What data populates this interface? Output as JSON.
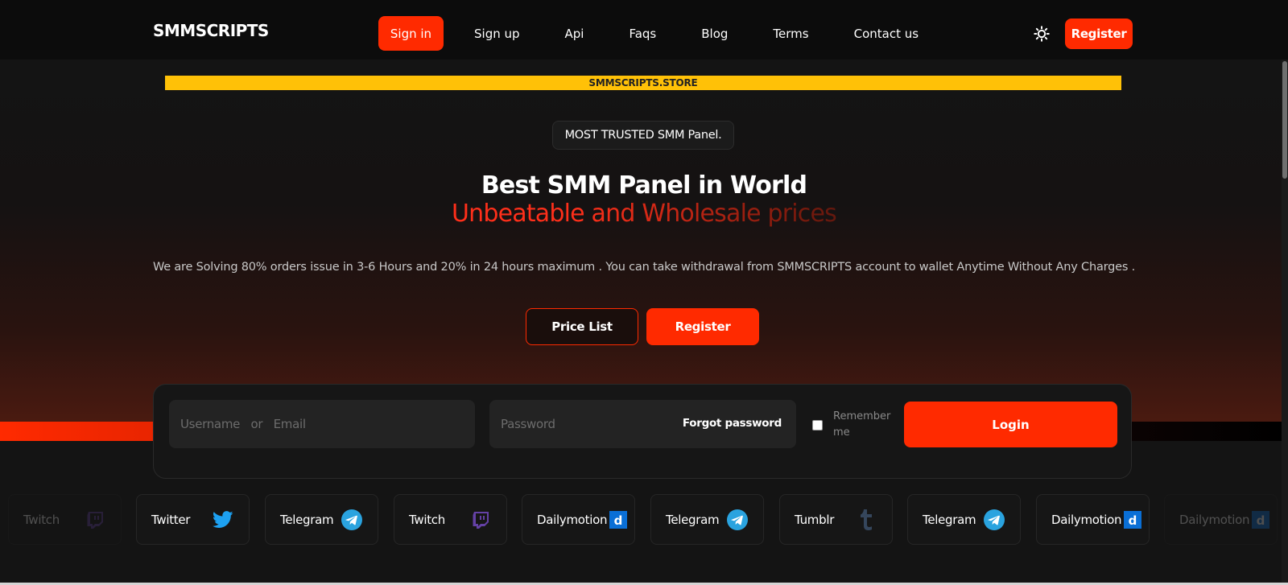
{
  "brand": "SMMSCRIPTS",
  "nav": {
    "items": [
      "Sign in",
      "Sign up",
      "Api",
      "Faqs",
      "Blog",
      "Terms",
      "Contact us"
    ],
    "active_index": 0,
    "register_label": "Register"
  },
  "banner": "SMMSCRIPTS.STORE",
  "hero": {
    "pill": "MOST TRUSTED SMM Panel.",
    "title": "Best SMM Panel in World",
    "subtitle": "Unbeatable and Wholesale prices",
    "description": "We are Solving 80% orders issue in 3-6 Hours and 20% in 24 hours maximum . You can take withdrawal from SMMSCRIPTS account to wallet Anytime Without Any Charges .",
    "price_list_label": "Price List",
    "register_label": "Register"
  },
  "login": {
    "username_placeholder": "Username   or   Email",
    "password_placeholder": "Password",
    "forgot_label": "Forgot password",
    "remember_label": "Remember me",
    "login_label": "Login"
  },
  "socials": [
    {
      "name": "Twitch",
      "icon": "twitch-icon",
      "faded": true
    },
    {
      "name": "Twitter",
      "icon": "twitter-icon",
      "faded": false
    },
    {
      "name": "Telegram",
      "icon": "telegram-icon",
      "faded": false
    },
    {
      "name": "Twitch",
      "icon": "twitch-icon",
      "faded": false
    },
    {
      "name": "Dailymotion",
      "icon": "dailymotion-icon",
      "faded": false
    },
    {
      "name": "Telegram",
      "icon": "telegram-icon",
      "faded": false
    },
    {
      "name": "Tumblr",
      "icon": "tumblr-icon",
      "faded": false
    },
    {
      "name": "Telegram",
      "icon": "telegram-icon",
      "faded": false
    },
    {
      "name": "Dailymotion",
      "icon": "dailymotion-icon",
      "faded": false
    },
    {
      "name": "Dailymotion",
      "icon": "dailymotion-icon",
      "faded": true
    }
  ],
  "colors": {
    "accent": "#ff2a00",
    "banner": "#ffc107",
    "background": "#141414",
    "twitch": "#6441a5",
    "twitter": "#1da1f2",
    "telegram": "#2aa3df",
    "dailymotion": "#0a6fd6",
    "tumblr": "#35465c"
  }
}
